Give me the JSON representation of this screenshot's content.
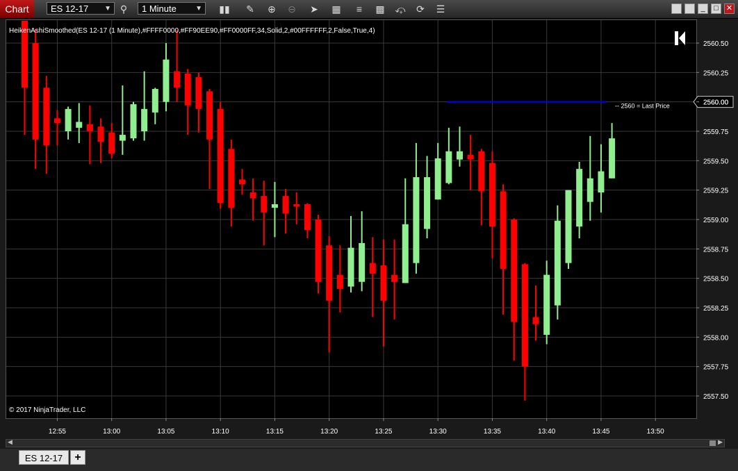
{
  "window": {
    "title": "Chart",
    "instrument": "ES 12-17",
    "interval": "1 Minute",
    "tab_label": "ES 12-17",
    "add_tab": "+",
    "minimize": "_",
    "maximize": "□",
    "close": "✕"
  },
  "toolbar": {
    "icons": [
      "search-icon",
      "bar-type-icon",
      "pen-icon",
      "zoom-in-icon",
      "zoom-out-icon",
      "pointer-icon",
      "data-box-icon",
      "indicators-icon",
      "templates-icon",
      "strategies-icon",
      "refresh-icon",
      "properties-icon"
    ]
  },
  "chart": {
    "indicator_label": "HeikenAshiSmoothed(ES 12-17 (1 Minute),#FFFF0000,#FF90EE90,#FF0000FF,34,Solid,2,#00FFFFFF,2,False,True,4)",
    "copyright": "© 2017 NinjaTrader, LLC",
    "logo_glyph": "K",
    "last_price_label": "2560 = Last Price",
    "last_price_marker": "2560.00",
    "colors": {
      "up": "#90EE90",
      "down": "#FF0000",
      "last_price_line": "#0000FF",
      "grid": "#3a3a3a",
      "background": "#000000"
    }
  },
  "chart_data": {
    "type": "candlestick",
    "y_ticks": [
      "2560.50",
      "2560.25",
      "2560.00",
      "2559.75",
      "2559.50",
      "2559.25",
      "2559.00",
      "2558.75",
      "2558.50",
      "2558.25",
      "2558.00",
      "2557.75",
      "2557.50"
    ],
    "ylim": [
      2557.35,
      2560.75
    ],
    "x_ticks": [
      "12:55",
      "13:00",
      "13:05",
      "13:10",
      "13:15",
      "13:20",
      "13:25",
      "13:30",
      "13:35",
      "13:40",
      "13:45",
      "13:50"
    ],
    "x_tick_index": [
      3,
      8,
      13,
      18,
      23,
      28,
      33,
      38,
      43,
      48,
      53,
      58
    ],
    "last_price": 2560.0,
    "last_price_line_range": [
      39,
      53.5
    ],
    "candles": [
      {
        "i": 0,
        "o": 2560.75,
        "h": 2560.75,
        "c": 2560.12,
        "l": 2559.72
      },
      {
        "i": 1,
        "o": 2560.5,
        "h": 2560.62,
        "c": 2559.68,
        "l": 2559.43
      },
      {
        "i": 2,
        "o": 2560.12,
        "h": 2560.22,
        "c": 2559.63,
        "l": 2559.39
      },
      {
        "i": 3,
        "o": 2559.86,
        "h": 2559.93,
        "c": 2559.82,
        "l": 2559.63
      },
      {
        "i": 4,
        "o": 2559.75,
        "h": 2559.96,
        "c": 2559.94,
        "l": 2559.68
      },
      {
        "i": 5,
        "o": 2559.78,
        "h": 2559.99,
        "c": 2559.83,
        "l": 2559.65
      },
      {
        "i": 6,
        "o": 2559.81,
        "h": 2559.97,
        "c": 2559.75,
        "l": 2559.47
      },
      {
        "i": 7,
        "o": 2559.79,
        "h": 2559.86,
        "c": 2559.66,
        "l": 2559.48
      },
      {
        "i": 8,
        "o": 2559.74,
        "h": 2559.82,
        "c": 2559.56,
        "l": 2559.52
      },
      {
        "i": 9,
        "o": 2559.67,
        "h": 2560.14,
        "c": 2559.72,
        "l": 2559.55
      },
      {
        "i": 10,
        "o": 2559.69,
        "h": 2560.0,
        "c": 2559.98,
        "l": 2559.67
      },
      {
        "i": 11,
        "o": 2559.75,
        "h": 2560.26,
        "c": 2559.94,
        "l": 2559.67
      },
      {
        "i": 12,
        "o": 2559.91,
        "h": 2560.12,
        "c": 2560.11,
        "l": 2559.81
      },
      {
        "i": 13,
        "o": 2560.0,
        "h": 2560.5,
        "c": 2560.36,
        "l": 2559.92
      },
      {
        "i": 14,
        "o": 2560.26,
        "h": 2560.61,
        "c": 2560.12,
        "l": 2560.0
      },
      {
        "i": 15,
        "o": 2560.24,
        "h": 2560.28,
        "c": 2559.97,
        "l": 2559.72
      },
      {
        "i": 16,
        "o": 2560.21,
        "h": 2560.25,
        "c": 2559.94,
        "l": 2559.74
      },
      {
        "i": 17,
        "o": 2560.09,
        "h": 2560.11,
        "c": 2559.68,
        "l": 2559.26
      },
      {
        "i": 18,
        "o": 2559.94,
        "h": 2560.0,
        "c": 2559.14,
        "l": 2559.09
      },
      {
        "i": 19,
        "o": 2559.6,
        "h": 2559.68,
        "c": 2559.1,
        "l": 2558.94
      },
      {
        "i": 20,
        "o": 2559.34,
        "h": 2559.43,
        "c": 2559.3,
        "l": 2559.21
      },
      {
        "i": 21,
        "o": 2559.23,
        "h": 2559.35,
        "c": 2559.18,
        "l": 2558.99
      },
      {
        "i": 22,
        "o": 2559.2,
        "h": 2559.33,
        "c": 2559.06,
        "l": 2558.78
      },
      {
        "i": 23,
        "o": 2559.1,
        "h": 2559.32,
        "c": 2559.13,
        "l": 2558.85
      },
      {
        "i": 24,
        "o": 2559.2,
        "h": 2559.26,
        "c": 2559.05,
        "l": 2558.88
      },
      {
        "i": 25,
        "o": 2559.13,
        "h": 2559.23,
        "c": 2559.11,
        "l": 2558.96
      },
      {
        "i": 26,
        "o": 2559.13,
        "h": 2559.14,
        "c": 2558.91,
        "l": 2558.84
      },
      {
        "i": 27,
        "o": 2559.0,
        "h": 2559.04,
        "c": 2558.47,
        "l": 2558.37
      },
      {
        "i": 28,
        "o": 2558.78,
        "h": 2558.86,
        "c": 2558.31,
        "l": 2557.87
      },
      {
        "i": 29,
        "o": 2558.53,
        "h": 2558.78,
        "c": 2558.41,
        "l": 2558.21
      },
      {
        "i": 30,
        "o": 2558.43,
        "h": 2559.03,
        "c": 2558.76,
        "l": 2558.38
      },
      {
        "i": 31,
        "o": 2558.47,
        "h": 2559.07,
        "c": 2558.8,
        "l": 2558.39
      },
      {
        "i": 32,
        "o": 2558.63,
        "h": 2558.85,
        "c": 2558.54,
        "l": 2558.17
      },
      {
        "i": 33,
        "o": 2558.61,
        "h": 2558.83,
        "c": 2558.31,
        "l": 2557.92
      },
      {
        "i": 34,
        "o": 2558.53,
        "h": 2558.83,
        "c": 2558.47,
        "l": 2558.15
      },
      {
        "i": 35,
        "o": 2558.46,
        "h": 2559.35,
        "c": 2558.96,
        "l": 2558.46
      },
      {
        "i": 36,
        "o": 2558.63,
        "h": 2559.65,
        "c": 2559.36,
        "l": 2558.54
      },
      {
        "i": 37,
        "o": 2558.92,
        "h": 2559.54,
        "c": 2559.36,
        "l": 2558.84
      },
      {
        "i": 38,
        "o": 2559.17,
        "h": 2559.65,
        "c": 2559.52,
        "l": 2559.17
      },
      {
        "i": 39,
        "o": 2559.31,
        "h": 2559.78,
        "c": 2559.58,
        "l": 2559.3
      },
      {
        "i": 40,
        "o": 2559.51,
        "h": 2559.79,
        "c": 2559.58,
        "l": 2559.45
      },
      {
        "i": 41,
        "o": 2559.55,
        "h": 2559.72,
        "c": 2559.51,
        "l": 2559.25
      },
      {
        "i": 42,
        "o": 2559.58,
        "h": 2559.6,
        "c": 2559.24,
        "l": 2558.95
      },
      {
        "i": 43,
        "o": 2559.48,
        "h": 2559.58,
        "c": 2558.94,
        "l": 2558.67
      },
      {
        "i": 44,
        "o": 2559.24,
        "h": 2559.3,
        "c": 2558.58,
        "l": 2558.19
      },
      {
        "i": 45,
        "o": 2559.0,
        "h": 2559.01,
        "c": 2558.13,
        "l": 2557.8
      },
      {
        "i": 46,
        "o": 2558.62,
        "h": 2558.63,
        "c": 2557.75,
        "l": 2557.46
      },
      {
        "i": 47,
        "o": 2558.17,
        "h": 2558.44,
        "c": 2558.11,
        "l": 2557.97
      },
      {
        "i": 48,
        "o": 2558.02,
        "h": 2558.65,
        "c": 2558.53,
        "l": 2557.94
      },
      {
        "i": 49,
        "o": 2558.27,
        "h": 2559.12,
        "c": 2558.99,
        "l": 2558.15
      },
      {
        "i": 50,
        "o": 2558.63,
        "h": 2559.25,
        "c": 2559.25,
        "l": 2558.58
      },
      {
        "i": 51,
        "o": 2558.94,
        "h": 2559.49,
        "c": 2559.43,
        "l": 2558.84
      },
      {
        "i": 52,
        "o": 2559.15,
        "h": 2559.71,
        "c": 2559.35,
        "l": 2558.99
      },
      {
        "i": 53,
        "o": 2559.23,
        "h": 2559.64,
        "c": 2559.41,
        "l": 2559.06
      },
      {
        "i": 54,
        "o": 2559.35,
        "h": 2559.82,
        "c": 2559.69,
        "l": 2559.35
      }
    ]
  }
}
